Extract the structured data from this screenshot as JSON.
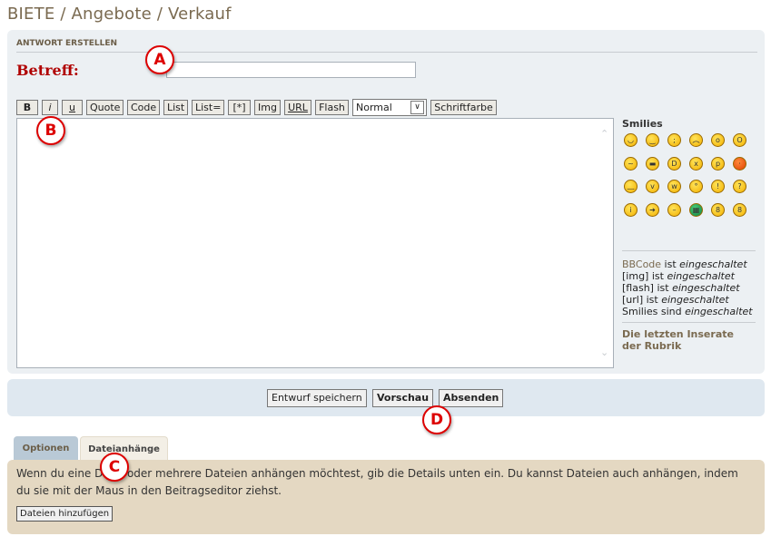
{
  "title": "BIETE / Angebote / Verkauf",
  "section": "ANTWORT ERSTELLEN",
  "subject": {
    "label": "Betreff:",
    "value": ""
  },
  "toolbar": {
    "buttons": [
      "B",
      "i",
      "u",
      "Quote",
      "Code",
      "List",
      "List=",
      "[*]",
      "Img",
      "URL",
      "Flash"
    ],
    "font_size": "Normal",
    "color_button": "Schriftfarbe"
  },
  "editor": {
    "value": ""
  },
  "smilies": {
    "title": "Smilies",
    "icons": [
      "big-grin-icon",
      "smile-icon",
      "wink-icon",
      "sad-icon",
      "surprised-icon",
      "shocked-icon",
      "confused-icon",
      "cool-icon",
      "laughing-icon",
      "mad-icon",
      "razz-icon",
      "embarrassed-icon",
      "crying-icon",
      "evil-icon",
      "twisted-evil-icon",
      "rolling-eyes-icon",
      "exclamation-icon",
      "question-icon",
      "idea-icon",
      "arrow-icon",
      "neutral-icon",
      "mr-green-icon",
      "geek-icon",
      "uber-geek-icon"
    ]
  },
  "status": {
    "bbcode_link": "BBCode",
    "bbcode_rest": " ist ",
    "lines": [
      {
        "label": "[img] ist ",
        "state": "eingeschaltet"
      },
      {
        "label": "[flash] ist ",
        "state": "eingeschaltet"
      },
      {
        "label": "[url] ist ",
        "state": "eingeschaltet"
      },
      {
        "label": "Smilies sind ",
        "state": "eingeschaltet"
      }
    ],
    "bbcode_state": "eingeschaltet"
  },
  "last_ads": "Die letzten Inserate der Rubrik",
  "actions": {
    "draft": "Entwurf speichern",
    "preview": "Vorschau",
    "submit": "Absenden"
  },
  "tabs": [
    {
      "label": "Optionen",
      "active": false
    },
    {
      "label": "Dateianhänge",
      "active": true
    }
  ],
  "attachments": {
    "text": "Wenn du eine Datei oder mehrere Dateien anhängen möchtest, gib die Details unten ein. Du kannst Dateien auch anhängen, indem du sie mit der Maus in den Beitragseditor ziehst.",
    "add_button": "Dateien hinzufügen"
  },
  "callouts": [
    "A",
    "B",
    "C",
    "D"
  ],
  "colors": {
    "title": "#7a6a50",
    "label_red": "#b00000",
    "callout": "#dd0000"
  }
}
